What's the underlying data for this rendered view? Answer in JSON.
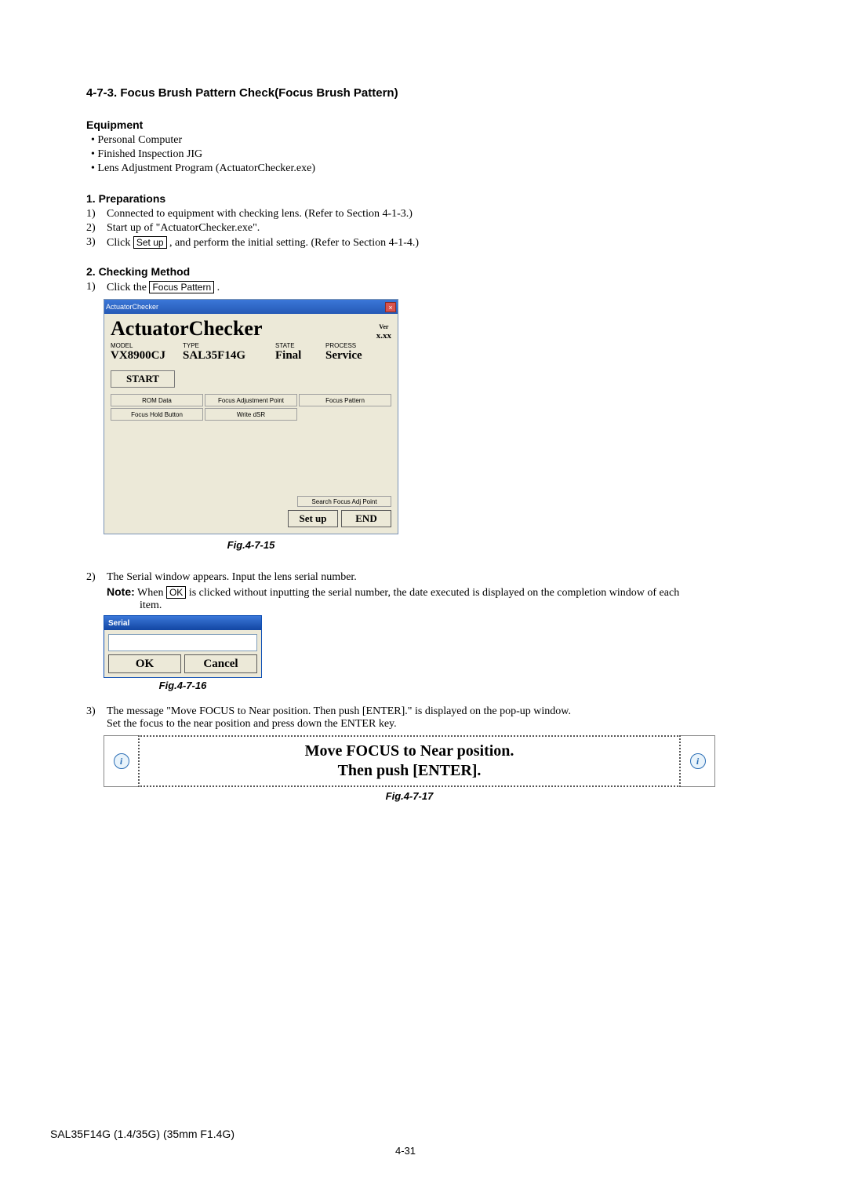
{
  "section": {
    "number": "4-7-3.",
    "title": "Focus Brush Pattern Check(Focus Brush Pattern)"
  },
  "equipment": {
    "heading": "Equipment",
    "items": [
      "Personal Computer",
      "Finished Inspection JIG",
      "Lens Adjustment Program (ActuatorChecker.exe)"
    ]
  },
  "preparations": {
    "heading": "1.   Preparations",
    "steps": {
      "1": "Connected to equipment with checking lens. (Refer to Section 4-1-3.)",
      "2": "Start up of \"ActuatorChecker.exe\".",
      "3a": "Click ",
      "3box": "Set up",
      "3b": " , and perform the initial setting. (Refer to Section 4-1-4.)"
    }
  },
  "checking": {
    "heading": "2.   Checking Method",
    "step1a": "Click the ",
    "step1box": "Focus Pattern",
    "step1b": " ."
  },
  "app": {
    "titlebar": "ActuatorChecker",
    "close": "×",
    "name": "ActuatorChecker",
    "ver_label": "Ver",
    "ver_value": "x.xx",
    "labels": {
      "model": "MODEL",
      "type": "TYPE",
      "state": "STATE",
      "process": "PROCESS"
    },
    "values": {
      "model": "VX8900CJ",
      "type": "SAL35F14G",
      "state": "Final",
      "process": "Service"
    },
    "start": "START",
    "buttons": {
      "rom_data": "ROM Data",
      "focus_adj_point": "Focus Adjustment Point",
      "focus_pattern": "Focus Pattern",
      "focus_hold": "Focus Hold Button",
      "write_dsr": "Write dSR"
    },
    "search_adj": "Search Focus Adj Point",
    "setup": "Set up",
    "end": "END"
  },
  "fig1": "Fig.4-7-15",
  "step2": {
    "text": "The Serial window appears. Input the lens serial number.",
    "note_label": "Note:",
    "note_a": "When ",
    "note_box": "OK",
    "note_b": " is clicked without inputting the serial number, the date executed is displayed on the completion window of each",
    "note_c": "item."
  },
  "serial": {
    "title": "Serial",
    "ok": "OK",
    "cancel": "Cancel"
  },
  "fig2": "Fig.4-7-16",
  "step3": {
    "a": "The message \"Move FOCUS to Near position. Then push [ENTER].\" is displayed on the pop-up window.",
    "b": "Set the focus to the near position and press down the ENTER key."
  },
  "popup": {
    "line1": "Move FOCUS to Near position.",
    "line2": "Then push [ENTER].",
    "icon": "i"
  },
  "fig3": "Fig.4-7-17",
  "footer": {
    "model": "SAL35F14G (1.4/35G) (35mm F1.4G)",
    "page": "4-31"
  }
}
